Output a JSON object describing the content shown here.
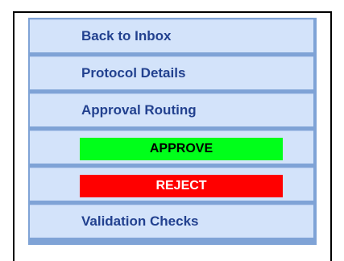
{
  "menu": {
    "items": [
      {
        "label": "Back to Inbox"
      },
      {
        "label": "Protocol Details"
      },
      {
        "label": "Approval Routing"
      }
    ],
    "approve_label": "APPROVE",
    "reject_label": "REJECT",
    "validation_label": "Validation Checks"
  },
  "colors": {
    "menu_bg": "#d3e3fa",
    "menu_border": "#7fa3d6",
    "link_text": "#22418f",
    "approve_bg": "#00ff1a",
    "reject_bg": "#ff0000"
  }
}
